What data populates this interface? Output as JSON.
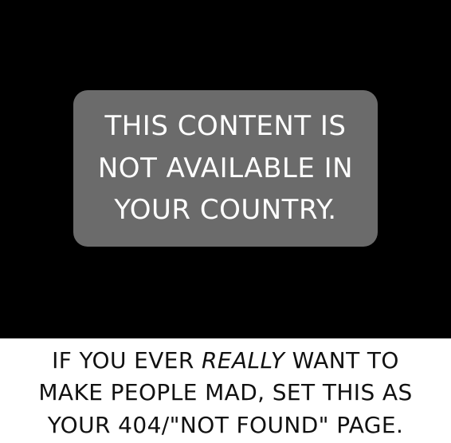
{
  "panel": {
    "background_color": "#000000",
    "box_color": "#6b6b6b",
    "message_lines": [
      "THIS CONTENT IS",
      "NOT AVAILABLE IN",
      "YOUR COUNTRY."
    ]
  },
  "caption": {
    "line1_pre": "IF YOU EVER ",
    "line1_emph": "REALLY",
    "line1_post": " WANT TO",
    "line2": "MAKE PEOPLE MAD, SET THIS AS",
    "line3": "YOUR 404/\"NOT FOUND\" PAGE."
  }
}
